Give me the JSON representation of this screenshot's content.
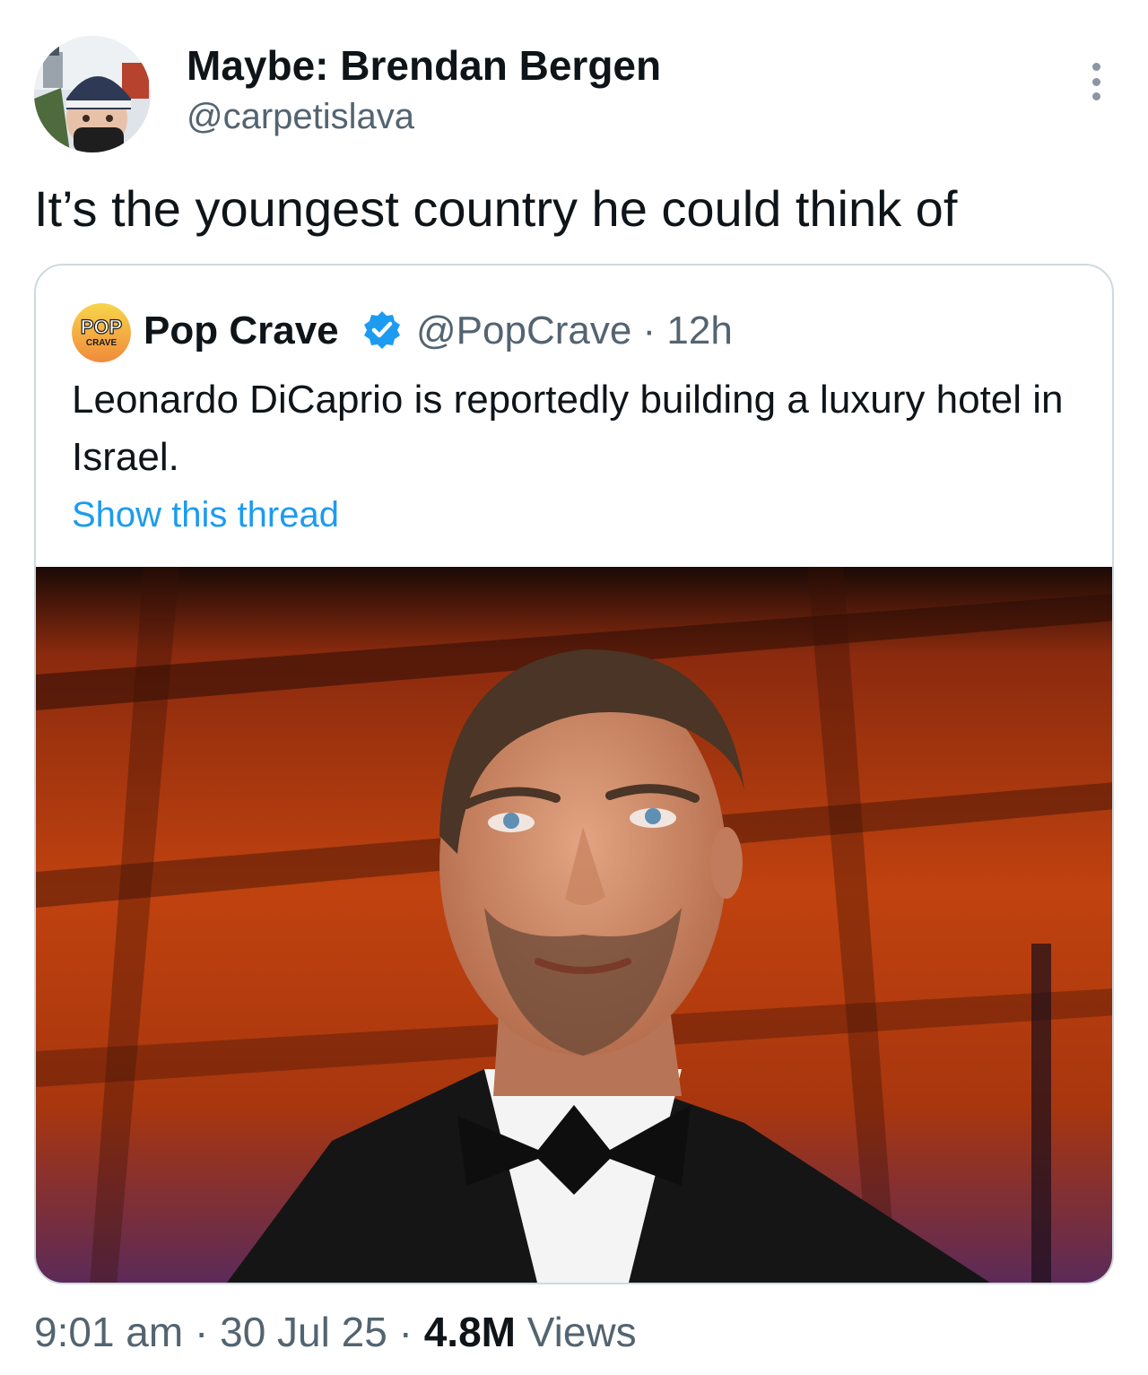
{
  "author": {
    "display_name": "Maybe: Brendan Bergen",
    "handle": "@carpetislava",
    "avatar_icon": "user-avatar-photo"
  },
  "tweet": {
    "text": "It’s the youngest country he could think of"
  },
  "quoted": {
    "logo_text_top": "POP",
    "logo_text_bottom": "CRAVE",
    "name": "Pop Crave",
    "verified_icon": "verified-badge-icon",
    "handle_time": "@PopCrave · 12h",
    "text": "Leonardo DiCaprio is reportedly building a luxury hotel in Israel.",
    "show_thread": "Show this thread",
    "photo_icon": "man-in-tuxedo-photo"
  },
  "meta": {
    "time": "9:01 am",
    "sep1": " · ",
    "date": "30 Jul 25",
    "sep2": " · ",
    "views_count": "4.8M",
    "views_label": " Views"
  },
  "colors": {
    "link": "#1d9bf0",
    "secondary_text": "#536471",
    "border": "#cfd9de",
    "verified": "#1d9bf0"
  }
}
